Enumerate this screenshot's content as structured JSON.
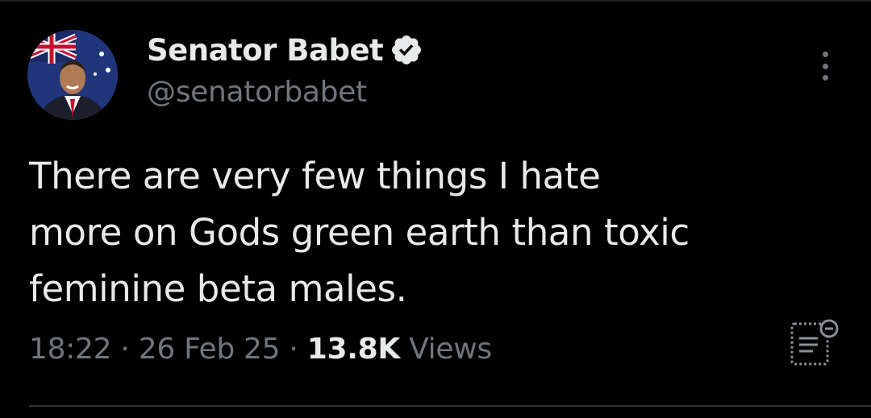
{
  "tweet": {
    "author": {
      "display_name": "Senator Babet",
      "handle": "@senatorbabet",
      "verified": true,
      "avatar": "avatar"
    },
    "text": "There are very few things I hate\nmore on Gods green earth than toxic\nfeminine beta males.",
    "time": "18:22",
    "date": "26 Feb 25",
    "separator": "·",
    "views_count": "13.8K",
    "views_label": "Views"
  },
  "icons": {
    "verified": "verified-badge-icon",
    "more": "more-options-icon",
    "analytics": "analytics-icon"
  },
  "colors": {
    "background": "#000000",
    "primary_text": "#e7e9ea",
    "secondary_text": "#71767b",
    "divider": "#2f3336"
  }
}
